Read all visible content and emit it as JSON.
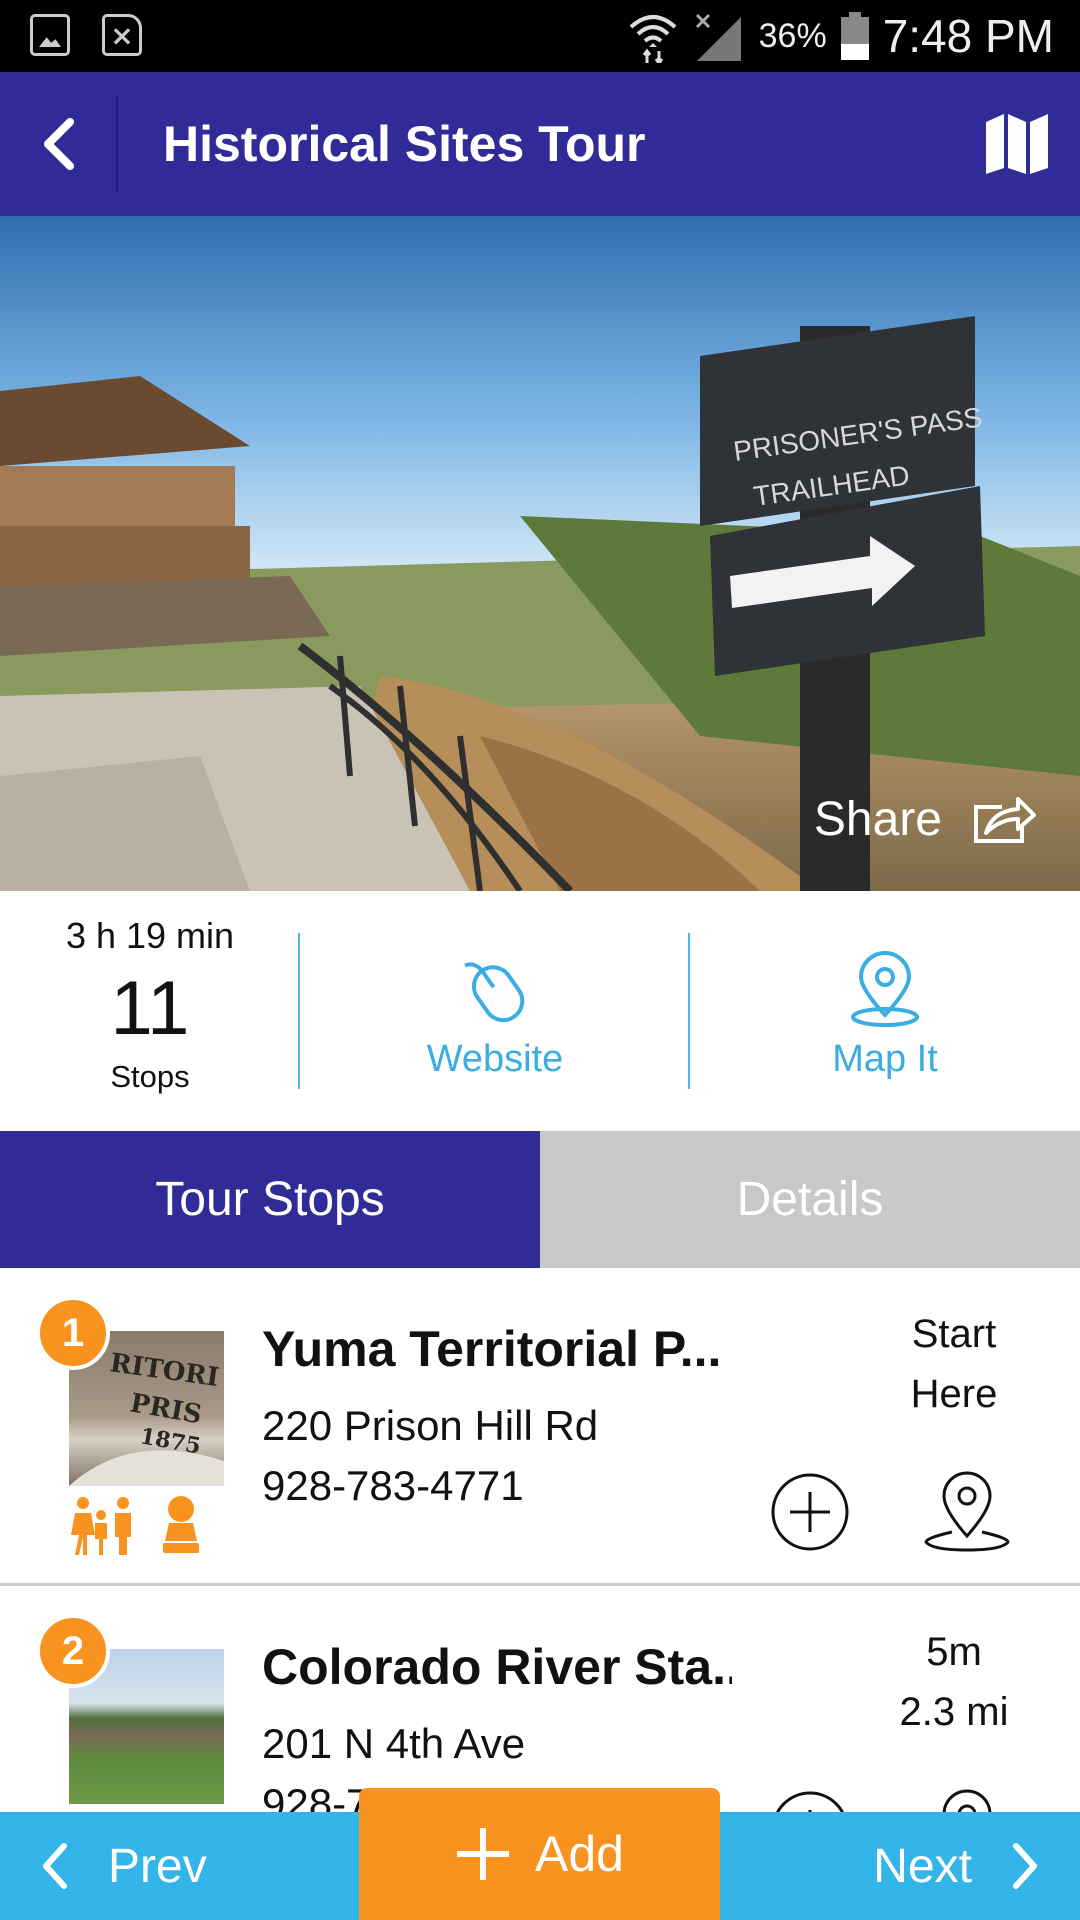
{
  "status_bar": {
    "battery_percent": "36%",
    "time": "7:48 PM",
    "notification_icons": [
      "image-icon",
      "document-x-icon"
    ],
    "right_icons": [
      "wifi-icon",
      "no-signal-icon",
      "battery-icon"
    ],
    "battery_level": 0.36
  },
  "app_bar": {
    "title": "Historical Sites Tour",
    "back_icon": "chevron-left-icon",
    "map_icon": "folded-map-icon",
    "background": "#302b96"
  },
  "hero": {
    "share_label": "Share",
    "share_icon": "share-arrow-icon"
  },
  "summary": {
    "duration": "3 h 19 min",
    "stops_count": "11",
    "stops_label": "Stops",
    "website_label": "Website",
    "map_it_label": "Map It",
    "accent": "#3aaee3"
  },
  "tabs": [
    {
      "label": "Tour Stops",
      "active": true
    },
    {
      "label": "Details",
      "active": false
    }
  ],
  "stops": [
    {
      "number": "1",
      "name": "Yuma Territorial P...",
      "address": "220 Prison Hill Rd",
      "phone": "928-783-4771",
      "meta_line1": "Start",
      "meta_line2": "Here",
      "amenity_icons": [
        "family-icon",
        "historic-bust-icon"
      ]
    },
    {
      "number": "2",
      "name": "Colorado River Sta..",
      "address": "201 N 4th Ave",
      "phone": "928-7",
      "meta_line1": "5m",
      "meta_line2": "2.3 mi"
    }
  ],
  "bottom_bar": {
    "prev_label": "Prev",
    "add_label": "Add",
    "next_label": "Next",
    "bar_color": "#33b5ea",
    "add_color": "#f7931e"
  }
}
